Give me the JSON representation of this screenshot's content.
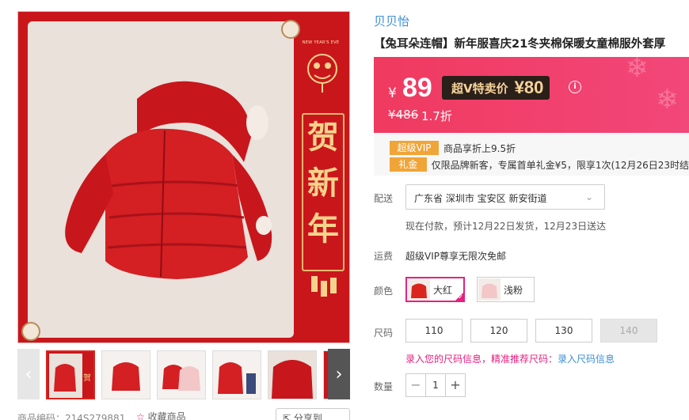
{
  "gallery": {
    "main_image_alt": "",
    "banner": {
      "top_text": "NEW YEAR'S EVE",
      "chars": [
        "贺",
        "新",
        "年"
      ]
    },
    "thumbnails": [
      {
        "name": "thumb-1",
        "active": true
      },
      {
        "name": "thumb-2",
        "active": false
      },
      {
        "name": "thumb-3",
        "active": false
      },
      {
        "name": "thumb-4",
        "active": false
      },
      {
        "name": "thumb-5",
        "active": false
      }
    ],
    "prev_glyph": "‹",
    "next_glyph": "›",
    "product_code_label": "商品编码：214S279881",
    "favorite_label": "收藏商品",
    "share_label": "分享到"
  },
  "product": {
    "brand": "贝贝怡",
    "title": "【兔耳朵连帽】新年服喜庆21冬夹棉保暖女童棉服外套厚"
  },
  "price": {
    "currency": "¥",
    "current": "89",
    "svip_label": "超V特卖价",
    "svip_price": "¥80",
    "info_icon": "i",
    "original": "¥486",
    "discount": "1.7折"
  },
  "promos": [
    {
      "tag": "超级VIP",
      "text": "商品享折上9.5折"
    },
    {
      "tag": "礼金",
      "text": "仅限品牌新客，专属首单礼金¥5，限享1次(12月26日23时结"
    }
  ],
  "delivery": {
    "label": "配送",
    "address": "广东省 深圳市 宝安区 新安街道",
    "note": "现在付款，预计12月22日发货，12月23日送达"
  },
  "freight": {
    "label": "运费",
    "text": "超级VIP尊享无限次免邮"
  },
  "color": {
    "label": "颜色",
    "options": [
      {
        "label": "大红",
        "selected": true,
        "swatch": "#d9251d"
      },
      {
        "label": "浅粉",
        "selected": false,
        "swatch": "#f3c6c8"
      }
    ]
  },
  "size": {
    "label": "尺码",
    "options": [
      {
        "label": "110",
        "disabled": false
      },
      {
        "label": "120",
        "disabled": false
      },
      {
        "label": "130",
        "disabled": false
      },
      {
        "label": "140",
        "disabled": true
      }
    ],
    "tip_warn": "录入您的尺码信息，精准推荐尺码：",
    "tip_link": "录入尺码信息"
  },
  "quantity": {
    "label": "数量",
    "value": "1",
    "minus": "−",
    "plus": "+"
  },
  "colors": {
    "price_bg": "#f03a5f",
    "svip_bg": "#2b1f1a",
    "promo_tag": "#f0a538",
    "accent": "#e6207e",
    "link": "#3b8ed8"
  }
}
